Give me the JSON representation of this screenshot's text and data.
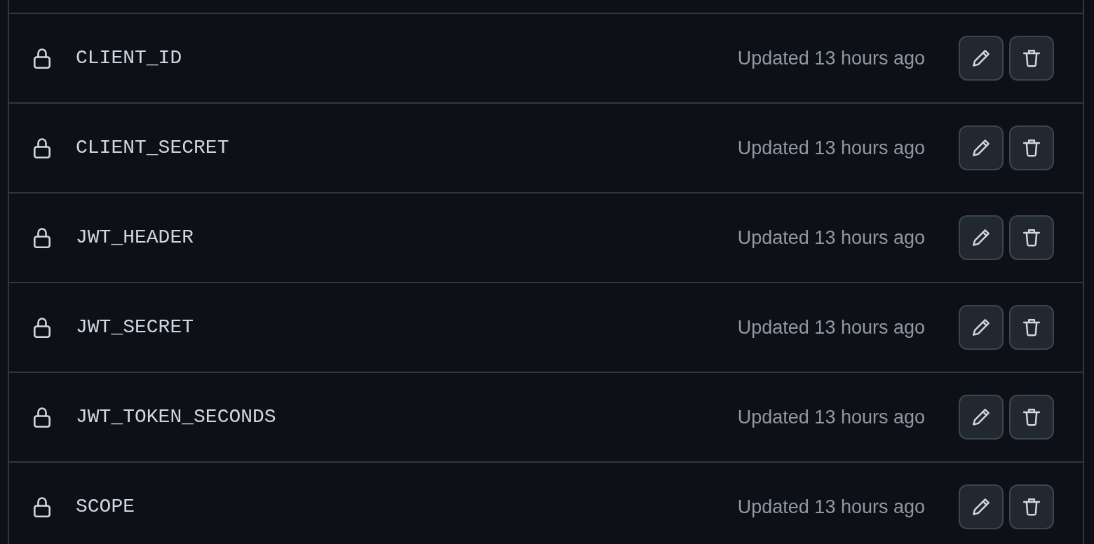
{
  "secrets": [
    {
      "name": "CLIENT_ID",
      "updated": "Updated 13 hours ago"
    },
    {
      "name": "CLIENT_SECRET",
      "updated": "Updated 13 hours ago"
    },
    {
      "name": "JWT_HEADER",
      "updated": "Updated 13 hours ago"
    },
    {
      "name": "JWT_SECRET",
      "updated": "Updated 13 hours ago"
    },
    {
      "name": "JWT_TOKEN_SECONDS",
      "updated": "Updated 13 hours ago"
    },
    {
      "name": "SCOPE",
      "updated": "Updated 13 hours ago"
    }
  ]
}
